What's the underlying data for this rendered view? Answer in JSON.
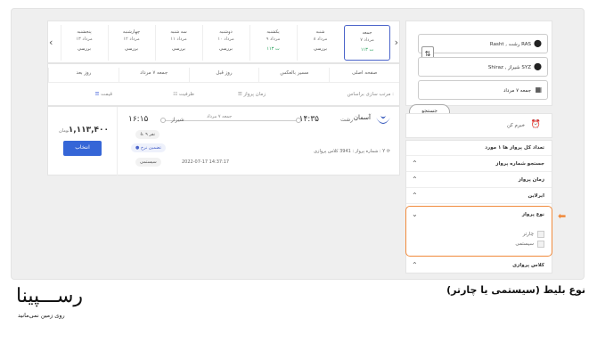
{
  "date_bar": {
    "days": [
      {
        "name": "جمعه",
        "date": "۷ مرداد",
        "price": "۱۱۳ ت",
        "active": true
      },
      {
        "name": "شنبه",
        "date": "۸ مرداد",
        "price": "بررسی"
      },
      {
        "name": "یکشنبه",
        "date": "۹ مرداد",
        "price": "۱۱۳ ت"
      },
      {
        "name": "دوشنبه",
        "date": "۱۰ مرداد",
        "price": "بررسی"
      },
      {
        "name": "سه شنبه",
        "date": "۱۱ مرداد",
        "price": "بررسی"
      },
      {
        "name": "چهارشنبه",
        "date": "۱۲ مرداد",
        "price": "بررسی"
      },
      {
        "name": "پنجشنبه",
        "date": "۱۳ مرداد",
        "price": "بررسی"
      }
    ]
  },
  "tabs": [
    "صفحه اصلی",
    "مسیر بالعکس",
    "روز قبل",
    "جمعه ۷ مرداد",
    "روز بعد"
  ],
  "sort": {
    "label": "مرتب سازی براساس :",
    "time": "زمان پرواز",
    "capacity": "ظرفیت",
    "price": "قیمت"
  },
  "flight": {
    "airline": "آسمان",
    "origin_city": "رشت",
    "origin_time": "۱۴:۳۵",
    "dest_city": "شیراز",
    "dest_time": "۱۶:۱۵",
    "date": "جمعه ۷ مرداد",
    "seats": "۹ نفر",
    "fare_guarantee": "تضمین نرخ",
    "type": "سیستمی",
    "meta": "شماره پرواز : 3941   کلاس پروازی : Y",
    "timestamp": "2022-07-17 14:37:17",
    "price": "۱,۱۱۳,۴۰۰",
    "currency": "تومان",
    "select_label": "انتخاب"
  },
  "search": {
    "origin": "Rasht , رشت RAS",
    "destination": "Shiraz , شیراز SYZ",
    "date": "جمعه ۷ مرداد",
    "button": "جستجو"
  },
  "notify_label": "خبرم کن",
  "filters": {
    "count": "تعداد کل پرواز ها ۱ مورد",
    "flight_number": "جستجو شماره پرواز",
    "flight_time": "زمان پرواز",
    "airline": "ایرلاین",
    "flight_type": "نوع پرواز",
    "charter": "چارتر",
    "system": "سیستمی",
    "class": "کلاس پروازی"
  },
  "brand": {
    "name": "رســـپینا",
    "tagline": "روی زمین نمی‌مانید"
  },
  "caption": "نوع بلیط (سیستمی یا چارتر)",
  "colors": {
    "accent": "#3566d7",
    "highlight": "#f08a3c"
  }
}
